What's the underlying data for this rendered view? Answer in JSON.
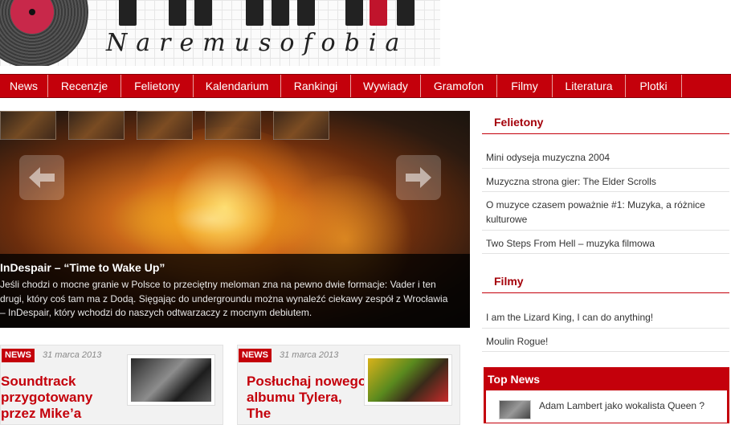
{
  "site": {
    "logo_text": "Naremusofobia"
  },
  "nav": {
    "items": [
      "News",
      "Recenzje",
      "Felietony",
      "Kalendarium",
      "Rankingi",
      "Wywiady",
      "Gramofon",
      "Filmy",
      "Literatura",
      "Plotki"
    ]
  },
  "slider": {
    "title": "InDespair – “Time to Wake Up”",
    "text": "Jeśli chodzi o mocne granie w Polsce to przeciętny meloman zna na pewno dwie formacje: Vader i ten drugi, który coś tam ma z Dodą. Sięgając do undergroundu można wynaleźć ciekawy zespół z Wrocławia – InDespair, który wchodzi do naszych odtwarzaczy z mocnym debiutem."
  },
  "articles": [
    {
      "badge": "NEWS",
      "date": "31 marca 2013",
      "title": "Soundtrack przygotowany przez Mike’a"
    },
    {
      "badge": "NEWS",
      "date": "31 marca 2013",
      "title": "Posłuchaj nowego albumu Tylera, The"
    }
  ],
  "sidebar": {
    "felietony": {
      "title": "Felietony",
      "items": [
        "Mini odyseja muzyczna 2004",
        "Muzyczna strona gier: The Elder Scrolls",
        "O muzyce czasem poważnie #1: Muzyka, a różnice kulturowe",
        "Two Steps From Hell – muzyka filmowa"
      ]
    },
    "filmy": {
      "title": "Filmy",
      "items": [
        "I am the Lizard King, I can do anything!",
        "Moulin Rogue!"
      ]
    },
    "topnews": {
      "title": "Top News",
      "items": [
        "Adam Lambert jako wokalista Queen ?"
      ]
    }
  }
}
